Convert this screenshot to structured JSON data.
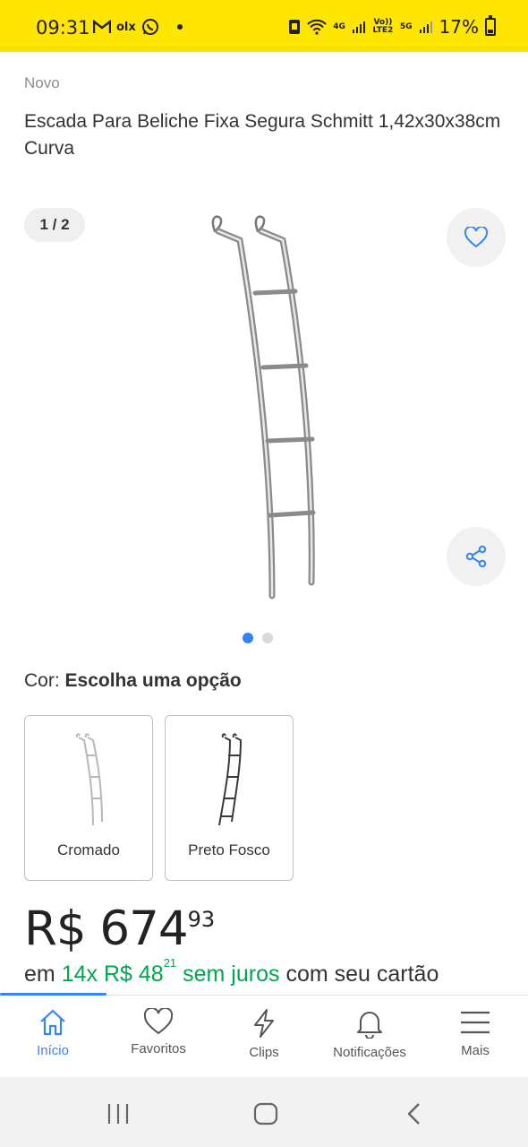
{
  "status_bar": {
    "time": "09:31",
    "app_icons": [
      "gmail-icon",
      "olx-icon",
      "whatsapp-icon"
    ],
    "olx_text": "olx",
    "network_volte": "Vo)) LTE2",
    "network_4g": "4G",
    "network_5g": "5G",
    "battery_percent": "17%"
  },
  "product": {
    "condition": "Novo",
    "title": "Escada Para Beliche Fixa Segura Schmitt 1,42x30x38cm Curva",
    "image_counter": "1 / 2",
    "image_count": 2,
    "active_image": 1
  },
  "variants": {
    "label": "Cor:",
    "prompt": "Escolha uma opção",
    "options": [
      {
        "name": "Cromado",
        "color": "#b8b8b8"
      },
      {
        "name": "Preto Fosco",
        "color": "#3a3a3a"
      }
    ]
  },
  "price": {
    "currency": "R$",
    "integer": "674",
    "cents": "93"
  },
  "installments": {
    "prefix": "em",
    "count": "14x",
    "currency": "R$",
    "integer": "48",
    "cents": "21",
    "interest": "sem juros",
    "suffix": "com seu cartão"
  },
  "bottom_nav": {
    "items": [
      {
        "label": "Início",
        "icon": "home-icon",
        "active": true
      },
      {
        "label": "Favoritos",
        "icon": "heart-icon",
        "active": false
      },
      {
        "label": "Clips",
        "icon": "lightning-icon",
        "active": false
      },
      {
        "label": "Notificações",
        "icon": "bell-icon",
        "active": false
      },
      {
        "label": "Mais",
        "icon": "menu-icon",
        "active": false
      }
    ]
  },
  "colors": {
    "brand_yellow": "#ffe600",
    "accent_blue": "#3483fa",
    "green": "#00a650"
  }
}
